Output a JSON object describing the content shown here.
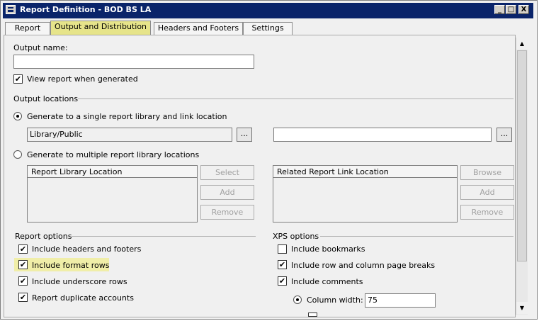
{
  "window": {
    "title": "Report Definition - BOD BS LA"
  },
  "title_buttons": {
    "minimize": "_",
    "maximize": "□",
    "close": "X"
  },
  "tabs": [
    {
      "label": "Report",
      "active": false
    },
    {
      "label": "Output and Distribution",
      "active": true
    },
    {
      "label": "Headers and Footers",
      "active": false
    },
    {
      "label": "Settings",
      "active": false
    }
  ],
  "output": {
    "name_label": "Output name:",
    "name_value": "",
    "view_report_label": "View report when generated",
    "view_report_checked": true
  },
  "locations": {
    "heading": "Output locations",
    "single_label": "Generate to a single report library and link location",
    "single_selected": true,
    "library_value": "Library/Public",
    "link_value": "",
    "browse_dots": "...",
    "multiple_label": "Generate to multiple report library locations",
    "library_list_header": "Report Library Location",
    "link_list_header": "Related Report Link Location",
    "select_button": "Select",
    "add_button": "Add",
    "remove_button": "Remove",
    "browse_button": "Browse",
    "add_button_2": "Add",
    "remove_button_2": "Remove"
  },
  "report_options": {
    "heading": "Report options",
    "items": [
      {
        "label": "Include headers and footers",
        "checked": true
      },
      {
        "label": "Include format rows",
        "checked": true
      },
      {
        "label": "Include underscore rows",
        "checked": true
      },
      {
        "label": "Report duplicate accounts",
        "checked": true
      }
    ]
  },
  "xps_options": {
    "heading": "XPS options",
    "items": [
      {
        "label": "Include bookmarks",
        "checked": false
      },
      {
        "label": "Include row and column page breaks",
        "checked": true
      },
      {
        "label": "Include comments",
        "checked": true
      }
    ],
    "column_width_label": "Column width:",
    "column_width_value": "75"
  },
  "scrollbar": {
    "up": "▲",
    "down": "▼"
  },
  "check_mark": "✔",
  "colors": {
    "title_bar": "#0a246a",
    "highlight": "#e6e48a"
  }
}
